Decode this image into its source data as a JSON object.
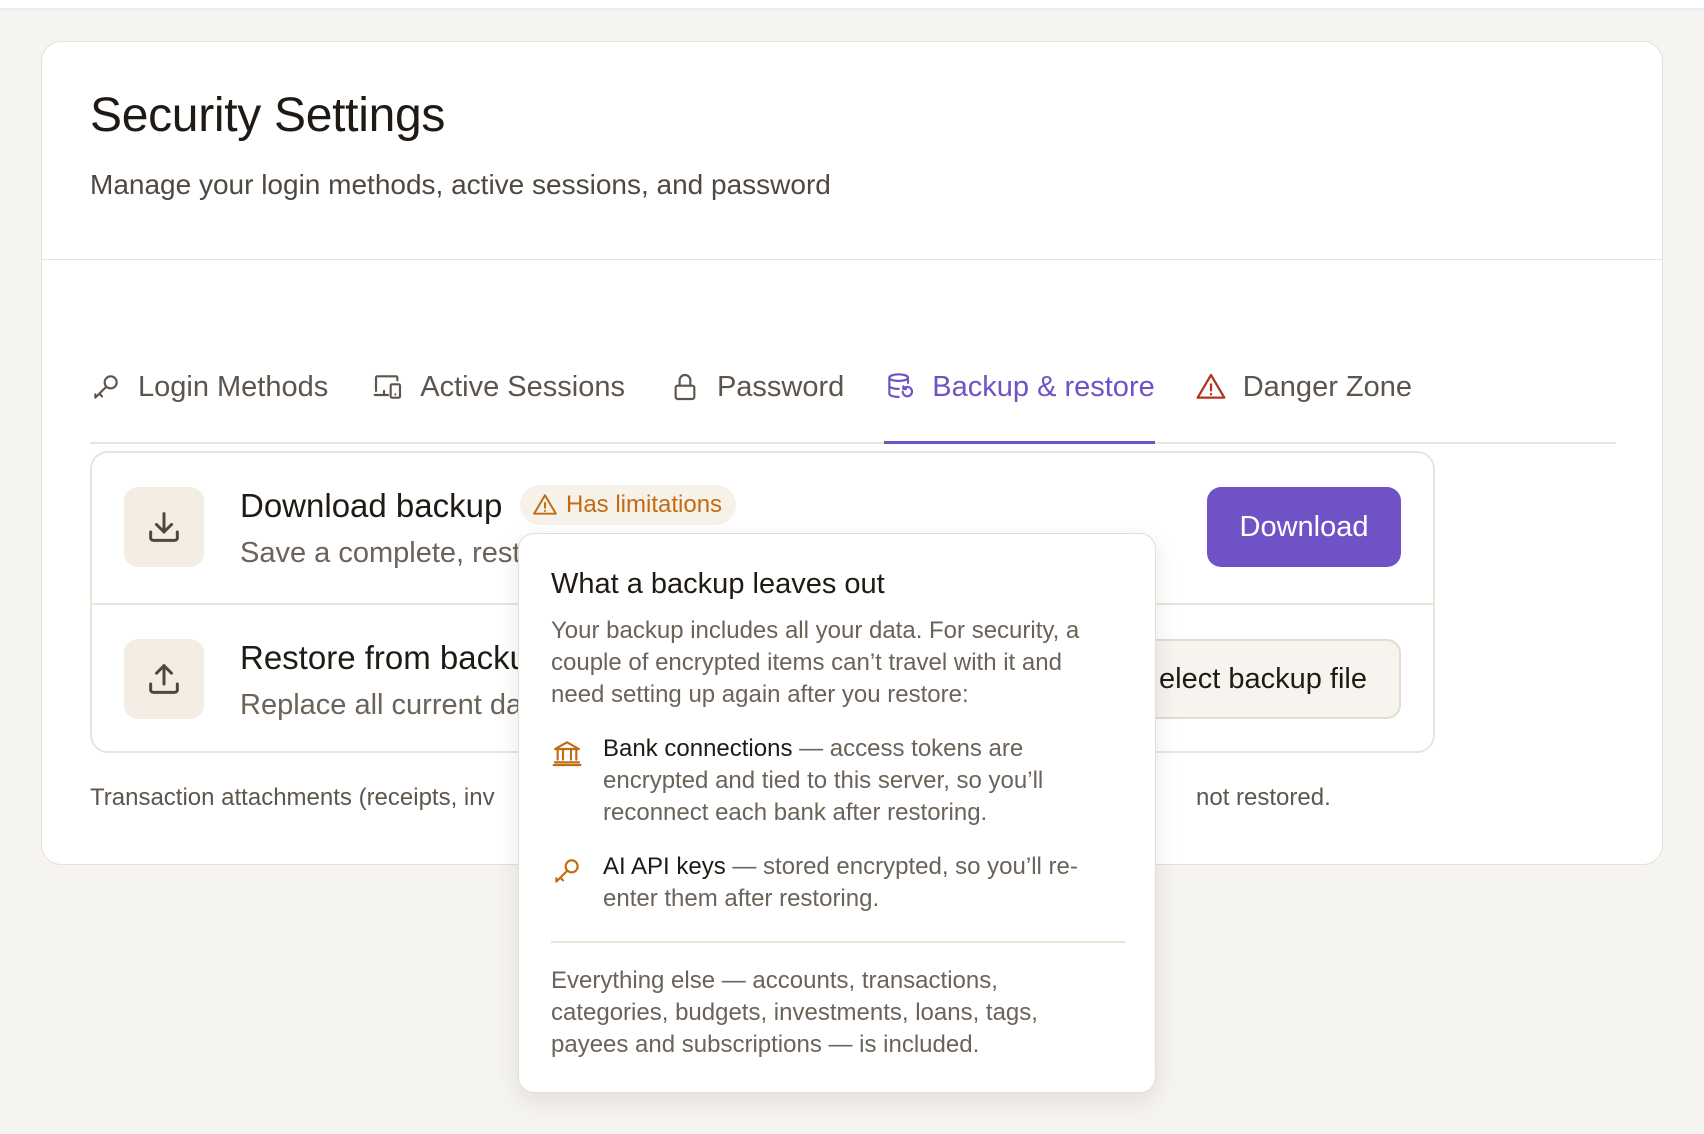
{
  "header": {
    "title": "Security Settings",
    "subtitle": "Manage your login methods, active sessions, and password"
  },
  "tabs": [
    {
      "label": "Login Methods",
      "icon": "key-icon",
      "active": false
    },
    {
      "label": "Active Sessions",
      "icon": "devices-icon",
      "active": false
    },
    {
      "label": "Password",
      "icon": "lock-icon",
      "active": false
    },
    {
      "label": "Backup & restore",
      "icon": "database-restore-icon",
      "active": true
    },
    {
      "label": "Danger Zone",
      "icon": "warning-triangle-icon",
      "active": false
    }
  ],
  "backup": {
    "download": {
      "title": "Download backup",
      "badge": "Has limitations",
      "description": "Save a complete, resto",
      "button": "Download"
    },
    "restore": {
      "title": "Restore from backu",
      "description": "Replace all current da",
      "button": "elect backup file"
    },
    "footnote_left": "Transaction attachments (receipts, inv",
    "footnote_right": "not restored."
  },
  "popover": {
    "title": "What a backup leaves out",
    "intro": "Your backup includes all your data. For security, a couple of encrypted items can’t travel with it and need setting up again after you restore:",
    "items": [
      {
        "icon": "bank-icon",
        "title": "Bank connections",
        "text": " — access tokens are encrypted and tied to this server, so you’ll reconnect each bank after restoring."
      },
      {
        "icon": "key-icon",
        "title": "AI API keys",
        "text": " — stored encrypted, so you’ll re-enter them after restoring."
      }
    ],
    "outro": "Everything else — accounts, transactions, categories, budgets, investments, loans, tags, payees and subscriptions — is included."
  },
  "colors": {
    "accent": "#7152c6",
    "warning": "#c26a14",
    "danger": "#b3351f"
  }
}
